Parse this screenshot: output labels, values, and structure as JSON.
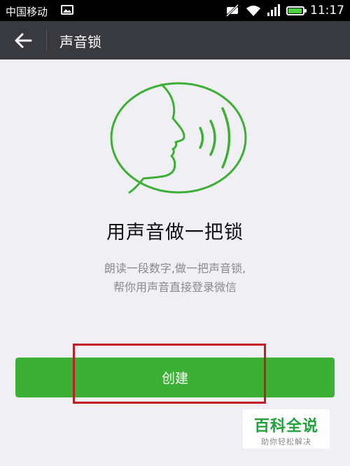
{
  "status_bar": {
    "carrier": "中国移动",
    "time": "11:17",
    "icons": [
      "image-icon",
      "mute-icon",
      "wifi-icon",
      "signal-icon",
      "battery-icon"
    ]
  },
  "app_bar": {
    "title": "声音锁",
    "back_icon": "back-arrow-icon"
  },
  "hero_icon": "face-speaking-icon",
  "main": {
    "heading": "用声音做一把锁",
    "description_line1": "朗读一段数字,做一把声音锁,",
    "description_line2": "帮你用声音直接登录微信"
  },
  "create_button": {
    "label": "创建"
  },
  "watermark": {
    "main": "百科全说",
    "sub": "助你轻松解决"
  },
  "colors": {
    "primary_green": "#3cb035",
    "app_bar": "#393a3f",
    "highlight_red": "#c21b26",
    "background": "#efeff4"
  }
}
